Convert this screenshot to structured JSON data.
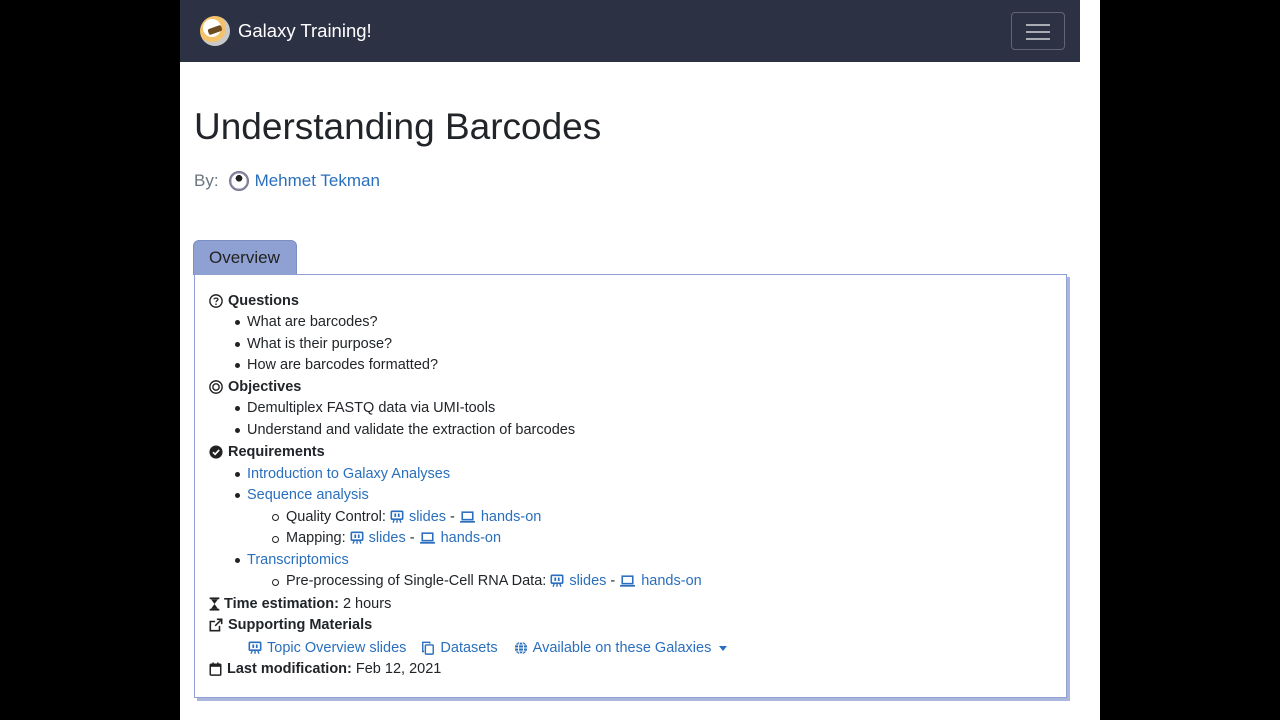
{
  "navbar": {
    "brand": "Galaxy Training!"
  },
  "page": {
    "title": "Understanding Barcodes",
    "by_label": "By:",
    "author": "Mehmet Tekman"
  },
  "overview": {
    "tab_label": "Overview",
    "questions": {
      "heading": "Questions",
      "items": [
        "What are barcodes?",
        "What is their purpose?",
        "How are barcodes formatted?"
      ]
    },
    "objectives": {
      "heading": "Objectives",
      "items": [
        "Demultiplex FASTQ data via UMI-tools",
        "Understand and validate the extraction of barcodes"
      ]
    },
    "requirements": {
      "heading": "Requirements",
      "intro_link": "Introduction to Galaxy Analyses",
      "seq_link": "Sequence analysis",
      "qc_label": "Quality Control:",
      "mapping_label": "Mapping:",
      "trans_link": "Transcriptomics",
      "preproc_label": "Pre-processing of Single-Cell RNA Data:",
      "slides": "slides",
      "dash": "-",
      "handson": "hands-on"
    },
    "time": {
      "heading": "Time estimation:",
      "value": "2 hours"
    },
    "supporting": {
      "heading": "Supporting Materials",
      "topic_slides": "Topic Overview slides",
      "datasets": "Datasets",
      "galaxies": "Available on these Galaxies"
    },
    "modification": {
      "heading": "Last modification:",
      "value": "Feb 12, 2021"
    }
  },
  "colors": {
    "navbar": "#2c3143",
    "link": "#2a6fbd",
    "tab": "#8ea1d2"
  }
}
